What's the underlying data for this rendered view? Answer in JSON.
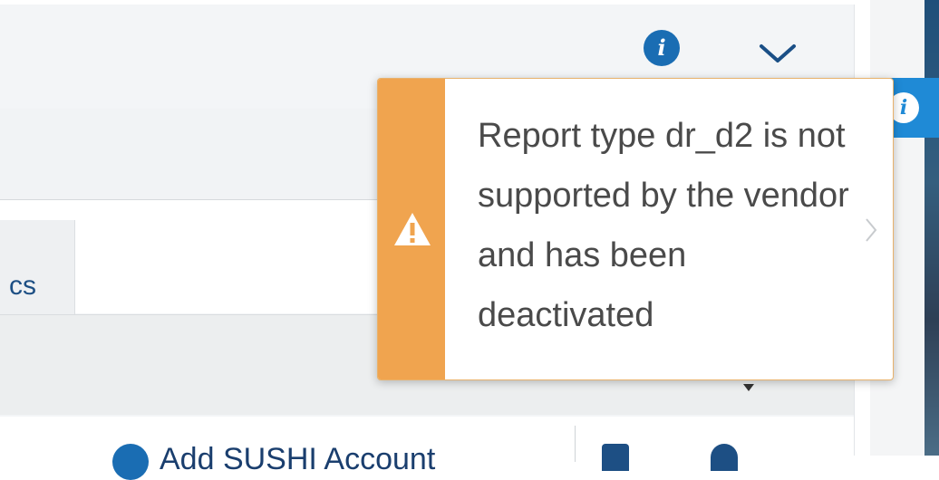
{
  "header": {
    "info_icon_glyph": "i",
    "collapse_icon": "chevron-down-icon"
  },
  "tabs": [
    {
      "label": "cs"
    }
  ],
  "toolbar": {
    "add_label": "Add SUSHI Account",
    "icons": [
      "add-circle-icon",
      "document-icon",
      "gear-icon"
    ]
  },
  "right_panel": {
    "info_glyph": "i"
  },
  "toast": {
    "type": "warning",
    "message": "Report type dr_d2 is not supported by the vendor and has been deactivated",
    "accent_color": "#f0a44f"
  }
}
